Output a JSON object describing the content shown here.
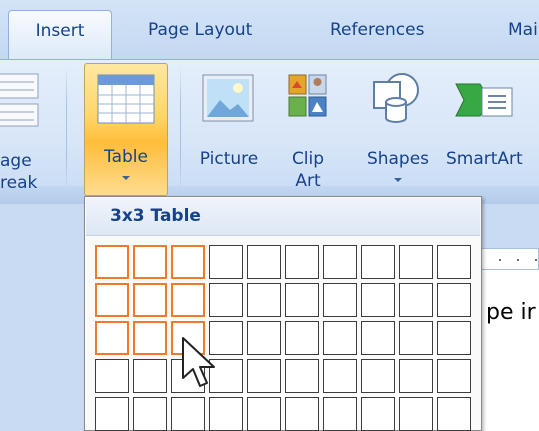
{
  "tabs": {
    "insert": "Insert",
    "page_layout": "Page Layout",
    "references": "References",
    "mailings": "Mai"
  },
  "ribbon": {
    "page_break_line1": "age",
    "page_break_line2": "reak",
    "table_label": "Table",
    "picture_label": "Picture",
    "clip_art_line1": "Clip",
    "clip_art_line2": "Art",
    "shapes_label": "Shapes",
    "smartart_label": "SmartArt"
  },
  "table_dropdown": {
    "header": "3x3 Table",
    "grid_columns": 10,
    "visible_rows": 5,
    "selected_columns": 3,
    "selected_rows": 3,
    "highlight_color": "#f07a28"
  },
  "document": {
    "text_fragment": "pe ir"
  },
  "colors": {
    "tab_text": "#15428b",
    "ribbon_bg": "#d8e6f8",
    "table_button_highlight": "#ffc84a"
  }
}
